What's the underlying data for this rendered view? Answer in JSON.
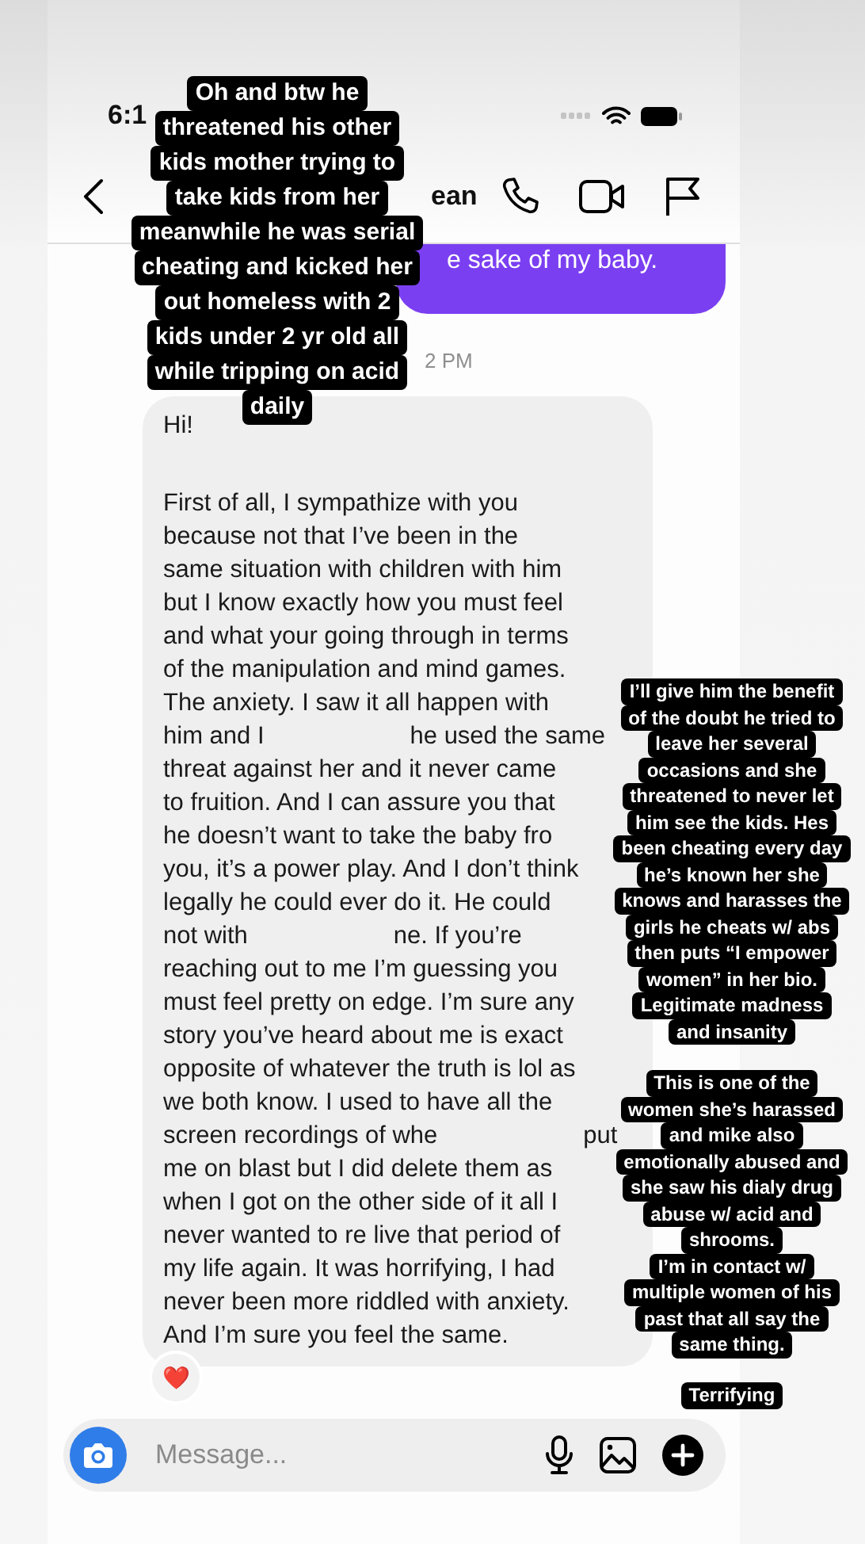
{
  "status_bar": {
    "time": "6:1"
  },
  "header": {
    "name": "ean"
  },
  "sent_message": {
    "text": "e sake of my baby."
  },
  "timestamp": "2 PM",
  "received_message": {
    "paragraphs": [
      [
        [
          "Hi!"
        ]
      ],
      [
        [
          "First of all, I sympathize with you"
        ],
        [
          "because not that I’ve been in the"
        ],
        [
          "same situation with children with him"
        ],
        [
          "but I know exactly how you must feel"
        ],
        [
          "and what your going through in terms"
        ],
        [
          "of the manipulation and mind games."
        ],
        [
          "The anxiety. I saw it all happen with"
        ],
        [
          "him and I",
          "he used the same"
        ],
        [
          "threat against her and it never came"
        ],
        [
          "to fruition. And I can assure you that"
        ],
        [
          "he doesn’t want to take the baby fro"
        ],
        [
          "you, it’s a power play. And I don’t think"
        ],
        [
          "legally he could ever do it. He could"
        ],
        [
          "not with",
          "ne. If you’re"
        ],
        [
          "reaching out to me I’m guessing you"
        ],
        [
          "must feel pretty on edge. I’m sure any"
        ],
        [
          "story you’ve heard about me is exact"
        ],
        [
          "opposite of whatever the truth is lol as"
        ],
        [
          "we both know. I used to have all the"
        ],
        [
          "screen recordings of whe",
          "put"
        ],
        [
          "me on blast but I did delete them as"
        ],
        [
          "when I got on the other side of it all I"
        ],
        [
          "never wanted to re live that period of"
        ],
        [
          "my life again. It was horrifying, I had"
        ],
        [
          "never been more riddled with anxiety."
        ],
        [
          "And I’m sure you feel the same."
        ]
      ]
    ],
    "reaction": "❤️"
  },
  "composer": {
    "placeholder": "Message..."
  },
  "captions": [
    {
      "kind": "large",
      "lines": [
        "Oh and btw he",
        "threatened his other",
        "kids mother trying to",
        "take kids from her",
        "meanwhile he was serial",
        "cheating and kicked her",
        "out homeless with 2",
        "kids under 2 yr old all",
        "while tripping on acid",
        "daily"
      ]
    },
    {
      "kind": "small",
      "lines": [
        "I’ll give him the benefit",
        "of the doubt he tried to",
        "leave her several",
        "occasions and she",
        "threatened to never let",
        "him see the kids. Hes",
        "been cheating every day",
        "he’s known her she",
        "knows and harasses the",
        "girls he cheats w/ abs",
        "then puts “I empower",
        "women” in her bio.",
        "Legitimate madness",
        "and insanity"
      ]
    },
    {
      "kind": "small",
      "lines": [
        "This is one of the",
        "women she’s harassed",
        "and mike also",
        "emotionally abused and",
        "she saw his dialy drug",
        "abuse w/ acid and",
        "shrooms.",
        "I’m in contact w/",
        "multiple women of his",
        "past that all say the",
        "same thing."
      ]
    },
    {
      "kind": "small",
      "lines": [
        "Terrifying"
      ]
    }
  ]
}
